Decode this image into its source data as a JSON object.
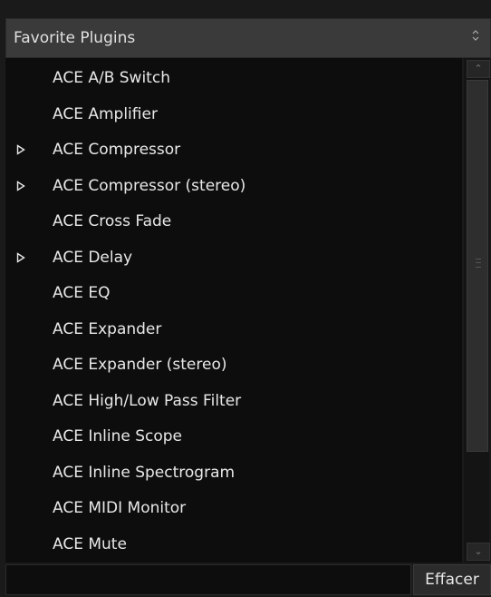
{
  "selector": {
    "value": "Favorite Plugins",
    "icon": "updown-arrows-icon"
  },
  "plugins": [
    {
      "label": "ACE A/B Switch",
      "has_presets": false
    },
    {
      "label": "ACE Amplifier",
      "has_presets": false
    },
    {
      "label": "ACE Compressor",
      "has_presets": true
    },
    {
      "label": "ACE Compressor (stereo)",
      "has_presets": true
    },
    {
      "label": "ACE Cross Fade",
      "has_presets": false
    },
    {
      "label": "ACE Delay",
      "has_presets": true
    },
    {
      "label": "ACE EQ",
      "has_presets": false
    },
    {
      "label": "ACE Expander",
      "has_presets": false
    },
    {
      "label": "ACE Expander (stereo)",
      "has_presets": false
    },
    {
      "label": "ACE High/Low Pass Filter",
      "has_presets": false
    },
    {
      "label": "ACE Inline Scope",
      "has_presets": false
    },
    {
      "label": "ACE Inline Spectrogram",
      "has_presets": false
    },
    {
      "label": "ACE MIDI Monitor",
      "has_presets": false
    },
    {
      "label": "ACE Mute",
      "has_presets": false
    }
  ],
  "expander_glyph": "ᐅ",
  "scrollbar": {
    "up_glyph": "⌃",
    "down_glyph": "⌄"
  },
  "filter": {
    "value": "",
    "placeholder": ""
  },
  "clear_button": {
    "label": "Effacer"
  }
}
